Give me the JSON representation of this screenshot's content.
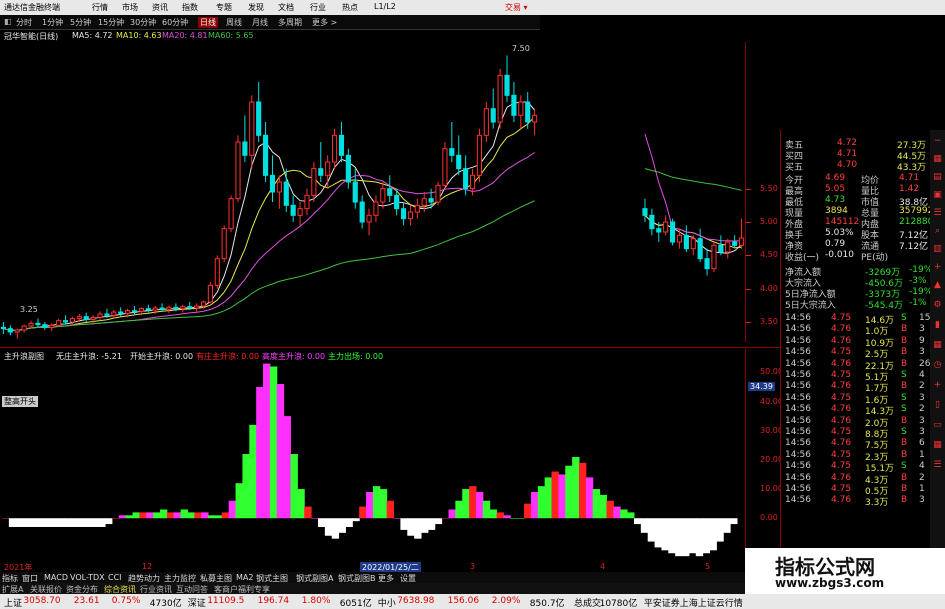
{
  "app": {
    "title": "通达信金融终端",
    "menu": [
      "行情",
      "市场",
      "资讯",
      "指数",
      "专题",
      "发现",
      "文档",
      "行业",
      "热点",
      "L1/L2"
    ],
    "trade_button": "交易 ▾"
  },
  "period_bar": {
    "items": [
      "分时",
      "1分钟",
      "5分钟",
      "15分钟",
      "30分钟",
      "60分钟",
      "日线",
      "周线",
      "月线",
      "多周期",
      "更多 >"
    ],
    "active": "日线"
  },
  "ma_legend": {
    "stock": "冠华智能(日线)",
    "items": [
      {
        "label": "MA5: 4.72",
        "color": "#e8e8e8"
      },
      {
        "label": "MA10: 4.63",
        "color": "#e8e850"
      },
      {
        "label": "MA20: 4.81",
        "color": "#e050e0"
      },
      {
        "label": "MA60: 5.65",
        "color": "#40c040"
      }
    ]
  },
  "main_chart": {
    "high_label": "7.50",
    "low_label": "3.25",
    "y_ticks": [
      "5.50",
      "5.00",
      "4.50",
      "4.00",
      "3.50"
    ],
    "y_range": [
      3.2,
      7.7
    ]
  },
  "sub_legend": {
    "name": "主升浪副图",
    "items": [
      {
        "label": "无庄主升浪: -5.21",
        "color": "#e8e8e8"
      },
      {
        "label": "开始主升浪: 0.00",
        "color": "#e8e8e8"
      },
      {
        "label": "有庄主升浪: 0.00",
        "color": "#ff2020"
      },
      {
        "label": "高度主升浪: 0.00",
        "color": "#ff40ff"
      },
      {
        "label": "主力出场: 0.00",
        "color": "#30ff30"
      }
    ]
  },
  "sub_chart": {
    "y_ticks": [
      "50.00",
      "40.00",
      "30.00",
      "20.00",
      "10.00",
      "0.00"
    ],
    "y_range": [
      -15,
      58
    ],
    "current_label": "34.39",
    "badge": "整高开头"
  },
  "time_axis": {
    "labels": [
      "2021年",
      "12",
      "2022/01/25/二",
      "3",
      "4",
      "5"
    ]
  },
  "indicator_bar": {
    "items": [
      "指标",
      "窗口",
      "MACD",
      "VOL-TDX",
      "CCI",
      "趋势动力",
      "主力监控",
      "私募主图",
      "MA2",
      "钢式主图",
      "钢式副图A",
      "钢式副图B",
      "更多",
      "设置"
    ]
  },
  "tabs_bar": {
    "items": [
      "扩展A",
      "关联报价",
      "资金分布",
      "综合资讯",
      "行业资讯",
      "互动问答",
      "客商户福利专享"
    ]
  },
  "quote_panel": {
    "top_rows": [
      {
        "label": "卖五",
        "price": "4.72",
        "vol": "27.3万"
      },
      {
        "label": "买四",
        "price": "4.71",
        "vol": "44.5万"
      },
      {
        "label": "买五",
        "price": "4.70",
        "vol": "43.3万"
      }
    ],
    "stats": [
      {
        "l1": "今开",
        "v1": "4.69",
        "c1": "#ff4040",
        "l2": "均价",
        "v2": "4.71",
        "c2": "#ff4040"
      },
      {
        "l1": "最高",
        "v1": "5.05",
        "c1": "#ff4040",
        "l2": "量比",
        "v2": "1.42",
        "c2": "#ff4040"
      },
      {
        "l1": "最低",
        "v1": "4.73",
        "c1": "#30e030",
        "l2": "市值",
        "v2": "38.8亿",
        "c2": "#e8e8e8"
      },
      {
        "l1": "现量",
        "v1": "3894",
        "c1": "#e8e850",
        "l2": "总量",
        "v2": "357992",
        "c2": "#e8e850"
      },
      {
        "l1": "外盘",
        "v1": "145112",
        "c1": "#ff4040",
        "l2": "内盘",
        "v2": "212880",
        "c2": "#30e030"
      },
      {
        "l1": "换手",
        "v1": "5.03%",
        "c1": "#e8e8e8",
        "l2": "股本",
        "v2": "7.12亿",
        "c2": "#e8e8e8"
      },
      {
        "l1": "净资",
        "v1": "0.79",
        "c1": "#e8e8e8",
        "l2": "流通",
        "v2": "7.12亿",
        "c2": "#e8e8e8"
      },
      {
        "l1": "收益(一)",
        "v1": "-0.010",
        "c1": "#e8e8e8",
        "l2": "PE(动)",
        "v2": "",
        "c2": "#e8e8e8"
      }
    ],
    "flows": [
      {
        "label": "净流入额",
        "value": "-3269万",
        "pct": "-19%"
      },
      {
        "label": "大宗流入",
        "value": "-450.6万",
        "pct": "-3%"
      },
      {
        "label": "5日净流入额",
        "value": "-3373万",
        "pct": "-19%"
      },
      {
        "label": "5日大宗流入",
        "value": "-545.4万",
        "pct": "-1%"
      }
    ],
    "ticks": [
      {
        "time": "14:56",
        "price": "4.75",
        "vol": "14.6万",
        "side": "S",
        "n": "15"
      },
      {
        "time": "14:56",
        "price": "4.76",
        "vol": "1.0万",
        "side": "B",
        "n": "3"
      },
      {
        "time": "14:56",
        "price": "4.76",
        "vol": "10.9万",
        "side": "B",
        "n": "9"
      },
      {
        "time": "14:56",
        "price": "4.75",
        "vol": "2.5万",
        "side": "B",
        "n": "3"
      },
      {
        "time": "14:56",
        "price": "4.76",
        "vol": "22.1万",
        "side": "B",
        "n": "26"
      },
      {
        "time": "14:56",
        "price": "4.75",
        "vol": "5.1万",
        "side": "S",
        "n": "4"
      },
      {
        "time": "14:56",
        "price": "4.76",
        "vol": "1.7万",
        "side": "B",
        "n": "2"
      },
      {
        "time": "14:56",
        "price": "4.75",
        "vol": "1.6万",
        "side": "S",
        "n": "3"
      },
      {
        "time": "14:56",
        "price": "4.76",
        "vol": "14.3万",
        "side": "S",
        "n": "2"
      },
      {
        "time": "14:56",
        "price": "4.76",
        "vol": "2.0万",
        "side": "B",
        "n": "3"
      },
      {
        "time": "14:56",
        "price": "4.75",
        "vol": "8.8万",
        "side": "S",
        "n": "3"
      },
      {
        "time": "14:56",
        "price": "4.76",
        "vol": "7.5万",
        "side": "B",
        "n": "6"
      },
      {
        "time": "14:56",
        "price": "4.75",
        "vol": "2.3万",
        "side": "B",
        "n": "1"
      },
      {
        "time": "14:56",
        "price": "4.75",
        "vol": "15.1万",
        "side": "S",
        "n": "4"
      },
      {
        "time": "14:56",
        "price": "4.76",
        "vol": "4.3万",
        "side": "B",
        "n": "2"
      },
      {
        "time": "14:56",
        "price": "4.75",
        "vol": "0.5万",
        "side": "B",
        "n": "1"
      },
      {
        "time": "14:56",
        "price": "4.76",
        "vol": "3.3万",
        "side": "B",
        "n": "3"
      }
    ]
  },
  "status_bar": {
    "items": [
      {
        "text": "上证",
        "color": "#000"
      },
      {
        "text": "3058.70",
        "color": "#d00"
      },
      {
        "text": "23.61",
        "color": "#d00"
      },
      {
        "text": "0.75%",
        "color": "#d00"
      },
      {
        "text": "4730亿",
        "color": "#000"
      },
      {
        "text": "深证",
        "color": "#000"
      },
      {
        "text": "11109.5",
        "color": "#d00"
      },
      {
        "text": "196.74",
        "color": "#d00"
      },
      {
        "text": "1.80%",
        "color": "#d00"
      },
      {
        "text": "6051亿",
        "color": "#000"
      },
      {
        "text": "中小",
        "color": "#000"
      },
      {
        "text": "7638.98",
        "color": "#d00"
      },
      {
        "text": "156.06",
        "color": "#d00"
      },
      {
        "text": "2.09%",
        "color": "#d00"
      },
      {
        "text": "850.7亿",
        "color": "#000"
      },
      {
        "text": "总成交",
        "color": "#000"
      },
      {
        "text": "10780亿",
        "color": "#000"
      },
      {
        "text": "平安证券上海上证云行情",
        "color": "#000"
      }
    ]
  },
  "watermark": {
    "line1": "指标公式网",
    "line2": "www.zbgs3.com"
  },
  "colors": {
    "up": "#ff3030",
    "down": "#00e0e0",
    "ma5": "#e8e8e8",
    "ma10": "#e8e850",
    "ma20": "#e050e0",
    "ma60": "#40c040",
    "magenta": "#ff30ff",
    "green": "#30ff30",
    "red": "#ff2020"
  },
  "chart_data": {
    "type": "candlestick",
    "candles": [
      [
        3.42,
        3.5,
        3.32,
        3.4
      ],
      [
        3.4,
        3.45,
        3.3,
        3.35
      ],
      [
        3.35,
        3.4,
        3.25,
        3.38
      ],
      [
        3.38,
        3.46,
        3.34,
        3.44
      ],
      [
        3.44,
        3.52,
        3.4,
        3.48
      ],
      [
        3.48,
        3.55,
        3.42,
        3.46
      ],
      [
        3.46,
        3.5,
        3.38,
        3.42
      ],
      [
        3.42,
        3.48,
        3.36,
        3.45
      ],
      [
        3.45,
        3.55,
        3.42,
        3.52
      ],
      [
        3.52,
        3.6,
        3.46,
        3.5
      ],
      [
        3.5,
        3.58,
        3.44,
        3.55
      ],
      [
        3.55,
        3.62,
        3.5,
        3.58
      ],
      [
        3.58,
        3.64,
        3.5,
        3.54
      ],
      [
        3.54,
        3.6,
        3.48,
        3.57
      ],
      [
        3.57,
        3.66,
        3.52,
        3.62
      ],
      [
        3.62,
        3.7,
        3.56,
        3.6
      ],
      [
        3.6,
        3.68,
        3.55,
        3.65
      ],
      [
        3.65,
        3.72,
        3.58,
        3.63
      ],
      [
        3.63,
        3.7,
        3.57,
        3.67
      ],
      [
        3.67,
        3.74,
        3.6,
        3.66
      ],
      [
        3.66,
        3.72,
        3.6,
        3.7
      ],
      [
        3.7,
        3.76,
        3.64,
        3.68
      ],
      [
        3.68,
        3.74,
        3.62,
        3.71
      ],
      [
        3.71,
        3.78,
        3.66,
        3.69
      ],
      [
        3.69,
        3.75,
        3.63,
        3.72
      ],
      [
        3.72,
        3.78,
        3.66,
        3.7
      ],
      [
        3.7,
        3.76,
        3.64,
        3.73
      ],
      [
        3.73,
        3.8,
        3.68,
        3.71
      ],
      [
        3.71,
        3.78,
        3.65,
        3.74
      ],
      [
        3.74,
        3.82,
        3.7,
        3.8
      ],
      [
        3.8,
        4.1,
        3.78,
        4.05
      ],
      [
        4.05,
        4.5,
        4.0,
        4.45
      ],
      [
        4.45,
        4.95,
        4.4,
        4.9
      ],
      [
        4.9,
        5.4,
        4.85,
        5.35
      ],
      [
        5.35,
        6.3,
        5.3,
        6.2
      ],
      [
        6.2,
        6.6,
        5.9,
        6.0
      ],
      [
        6.0,
        6.9,
        5.8,
        6.8
      ],
      [
        6.8,
        7.1,
        6.2,
        6.3
      ],
      [
        6.3,
        6.5,
        5.6,
        5.7
      ],
      [
        5.7,
        6.0,
        5.3,
        5.45
      ],
      [
        5.45,
        5.7,
        5.2,
        5.6
      ],
      [
        5.6,
        5.8,
        5.15,
        5.25
      ],
      [
        5.25,
        5.4,
        5.0,
        5.1
      ],
      [
        5.1,
        5.3,
        4.95,
        5.2
      ],
      [
        5.2,
        5.5,
        5.1,
        5.4
      ],
      [
        5.4,
        5.9,
        5.3,
        5.8
      ],
      [
        5.8,
        6.2,
        5.6,
        5.7
      ],
      [
        5.7,
        6.0,
        5.5,
        5.9
      ],
      [
        5.9,
        6.4,
        5.8,
        6.3
      ],
      [
        6.3,
        6.5,
        5.9,
        6.0
      ],
      [
        6.0,
        6.1,
        5.5,
        5.6
      ],
      [
        5.6,
        5.8,
        5.2,
        5.3
      ],
      [
        5.3,
        5.4,
        4.9,
        5.0
      ],
      [
        5.0,
        5.2,
        4.8,
        5.1
      ],
      [
        5.1,
        5.4,
        5.0,
        5.3
      ],
      [
        5.3,
        5.6,
        5.2,
        5.5
      ],
      [
        5.5,
        5.7,
        5.3,
        5.4
      ],
      [
        5.4,
        5.5,
        5.1,
        5.2
      ],
      [
        5.2,
        5.3,
        4.95,
        5.05
      ],
      [
        5.05,
        5.25,
        4.95,
        5.15
      ],
      [
        5.15,
        5.35,
        5.05,
        5.25
      ],
      [
        5.25,
        5.45,
        5.15,
        5.35
      ],
      [
        5.35,
        5.5,
        5.2,
        5.3
      ],
      [
        5.3,
        5.6,
        5.25,
        5.55
      ],
      [
        5.55,
        6.2,
        5.5,
        6.1
      ],
      [
        6.1,
        6.5,
        5.9,
        6.0
      ],
      [
        6.0,
        6.3,
        5.7,
        5.8
      ],
      [
        5.8,
        6.0,
        5.4,
        5.5
      ],
      [
        5.5,
        5.8,
        5.4,
        5.7
      ],
      [
        5.7,
        6.4,
        5.6,
        6.3
      ],
      [
        6.3,
        6.8,
        6.2,
        6.7
      ],
      [
        6.7,
        7.0,
        6.4,
        6.5
      ],
      [
        6.5,
        7.3,
        6.4,
        7.2
      ],
      [
        7.2,
        7.5,
        6.8,
        6.9
      ],
      [
        6.9,
        7.1,
        6.5,
        6.6
      ],
      [
        6.6,
        6.9,
        6.4,
        6.8
      ],
      [
        6.8,
        6.95,
        6.4,
        6.5
      ],
      [
        6.5,
        6.7,
        6.3,
        6.6
      ],
      null,
      null,
      null,
      null,
      null,
      null,
      null,
      null,
      null,
      null,
      null,
      null,
      null,
      null,
      null,
      [
        5.2,
        5.35,
        5.0,
        5.1
      ],
      [
        5.1,
        5.2,
        4.8,
        4.9
      ],
      [
        4.9,
        5.0,
        4.7,
        4.85
      ],
      [
        4.85,
        5.1,
        4.8,
        5.0
      ],
      [
        5.0,
        5.05,
        4.65,
        4.7
      ],
      [
        4.7,
        4.9,
        4.6,
        4.8
      ],
      [
        4.8,
        4.95,
        4.55,
        4.6
      ],
      [
        4.6,
        4.8,
        4.5,
        4.75
      ],
      [
        4.75,
        4.9,
        4.4,
        4.45
      ],
      [
        4.45,
        4.6,
        4.2,
        4.3
      ],
      [
        4.3,
        4.7,
        4.25,
        4.65
      ],
      [
        4.65,
        4.8,
        4.5,
        4.55
      ],
      [
        4.55,
        4.75,
        4.45,
        4.7
      ],
      [
        4.7,
        4.8,
        4.6,
        4.65
      ],
      [
        4.65,
        5.05,
        4.6,
        4.76
      ]
    ],
    "histogram": [
      0,
      -3,
      -3,
      -3,
      -3,
      -3,
      -3,
      -3,
      -3,
      -3,
      -3,
      -3,
      -3,
      -3,
      -3,
      -2,
      0,
      1,
      1,
      2,
      2,
      2,
      2,
      3,
      2,
      2,
      3,
      2,
      2,
      2,
      1,
      1,
      2,
      6,
      12,
      22,
      32,
      45,
      53,
      52,
      46,
      35,
      22,
      10,
      4,
      0,
      -3,
      -6,
      -7,
      -5,
      -3,
      -1,
      4,
      9,
      11,
      10,
      6,
      0,
      -4,
      -6,
      -7,
      -5,
      -4,
      -2,
      0,
      3,
      6,
      10,
      11,
      9,
      6,
      3,
      2,
      1,
      0,
      0,
      5,
      9,
      11,
      14,
      16,
      15,
      18,
      21,
      19,
      14,
      10,
      8,
      6,
      4,
      3,
      2,
      -2,
      -5,
      -8,
      -10,
      -11,
      -12,
      -13,
      -13,
      -12,
      -13,
      -12,
      -11,
      -8,
      -5,
      -2
    ]
  }
}
